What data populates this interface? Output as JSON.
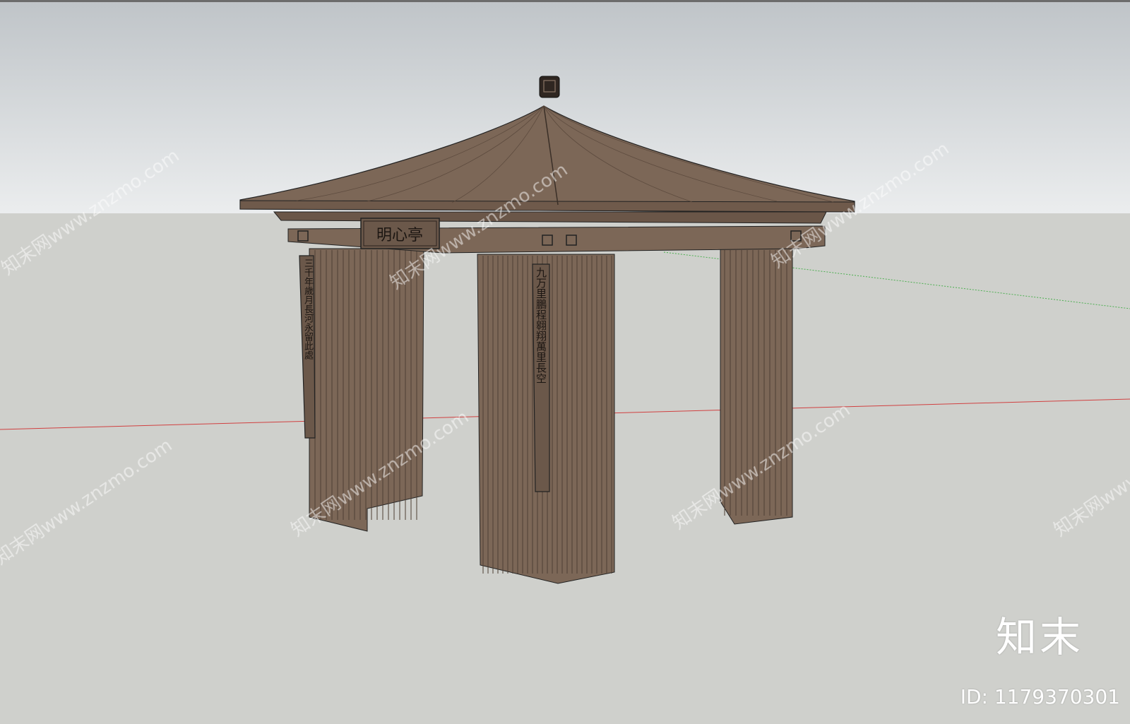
{
  "scene": {
    "sky_color_top": "#bfc4c8",
    "sky_color_bottom": "#ebedee",
    "ground_color": "#cfd0cc",
    "wood_color": "#7c6757",
    "wood_dark": "#4e3f35",
    "axis_red": "#d04040",
    "axis_green": "#4caf50"
  },
  "pavilion": {
    "plaque_text": "明心亭",
    "couplet_left": "三千年歲月長河永留此處",
    "couplet_right": "九万里鵬程翱翔萬里長空"
  },
  "watermark": {
    "text": "知末网www.znzmo.com",
    "brand": "知末",
    "id_label": "ID: 1179370301"
  }
}
